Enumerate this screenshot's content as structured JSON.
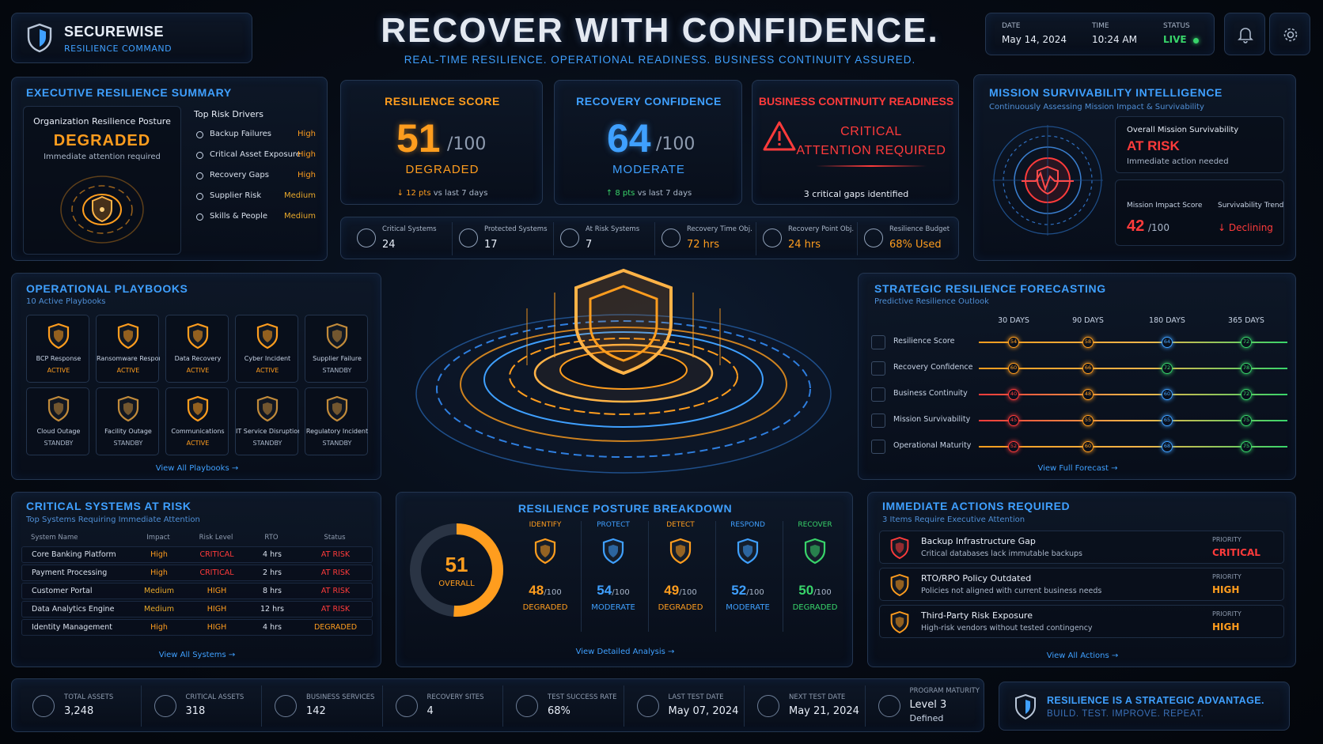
{
  "brand": {
    "name": "SECUREWISE",
    "tagline": "RESILIENCE COMMAND"
  },
  "hero": {
    "title": "RECOVER WITH CONFIDENCE.",
    "subtitle": "REAL-TIME RESILIENCE. OPERATIONAL READINESS. BUSINESS CONTINUITY ASSURED."
  },
  "header_status": {
    "date_label": "DATE",
    "date": "May 14, 2024",
    "time_label": "TIME",
    "time": "10:24 AM",
    "status_label": "STATUS",
    "status": "LIVE"
  },
  "exec_summary": {
    "title": "EXECUTIVE RESILIENCE SUMMARY",
    "posture_label": "Organization Resilience Posture",
    "posture": "DEGRADED",
    "posture_note": "Immediate attention required",
    "drivers_title": "Top Risk Drivers",
    "drivers": [
      {
        "name": "Backup Failures",
        "level": "High"
      },
      {
        "name": "Critical Asset Exposure",
        "level": "High"
      },
      {
        "name": "Recovery Gaps",
        "level": "High"
      },
      {
        "name": "Supplier Risk",
        "level": "Medium"
      },
      {
        "name": "Skills & People",
        "level": "Medium"
      }
    ]
  },
  "score_cards": {
    "resilience": {
      "title": "RESILIENCE SCORE",
      "value": "51",
      "max": "/100",
      "status": "DEGRADED",
      "trend_arrow": "↓",
      "trend": "12 pts",
      "trend_note": "vs last 7 days"
    },
    "confidence": {
      "title": "RECOVERY CONFIDENCE",
      "value": "64",
      "max": "/100",
      "status": "MODERATE",
      "trend_arrow": "↑",
      "trend": "8 pts",
      "trend_note": "vs last 7 days"
    },
    "continuity": {
      "title": "BUSINESS CONTINUITY READINESS",
      "line1": "CRITICAL",
      "line2": "ATTENTION REQUIRED",
      "note": "3 critical gaps identified"
    }
  },
  "metrics_strip": [
    {
      "label": "Critical Systems",
      "value": "24",
      "icon": "users-icon"
    },
    {
      "label": "Protected Systems",
      "value": "17",
      "icon": "shield-icon"
    },
    {
      "label": "At Risk Systems",
      "value": "7",
      "icon": "warning-icon"
    },
    {
      "label": "Recovery Time Obj.",
      "value": "72 hrs",
      "icon": "clock-icon"
    },
    {
      "label": "Recovery Point Obj.",
      "value": "24 hrs",
      "icon": "shield-check-icon"
    },
    {
      "label": "Resilience Budget",
      "value": "68% Used",
      "icon": "budget-icon"
    }
  ],
  "mission": {
    "title": "MISSION SURVIVABILITY INTELLIGENCE",
    "subtitle": "Continuously Assessing Mission Impact & Survivability",
    "overall_label": "Overall Mission Survivability",
    "overall": "AT RISK",
    "overall_note": "Immediate action needed",
    "impact_label": "Mission Impact Score",
    "impact_value": "42",
    "impact_max": "/100",
    "trend_label": "Survivability Trend",
    "trend": "↓ Declining"
  },
  "playbooks": {
    "title": "OPERATIONAL PLAYBOOKS",
    "subtitle": "10 Active Playbooks",
    "items": [
      {
        "name": "BCP Response",
        "status": "ACTIVE"
      },
      {
        "name": "Ransomware Response",
        "status": "ACTIVE"
      },
      {
        "name": "Data Recovery",
        "status": "ACTIVE"
      },
      {
        "name": "Cyber Incident",
        "status": "ACTIVE"
      },
      {
        "name": "Supplier Failure",
        "status": "STANDBY"
      },
      {
        "name": "Cloud Outage",
        "status": "STANDBY"
      },
      {
        "name": "Facility Outage",
        "status": "STANDBY"
      },
      {
        "name": "Communications",
        "status": "ACTIVE"
      },
      {
        "name": "IT Service Disruption",
        "status": "STANDBY"
      },
      {
        "name": "Regulatory Incident",
        "status": "STANDBY"
      }
    ],
    "link": "View All Playbooks →"
  },
  "forecast": {
    "title": "STRATEGIC RESILIENCE FORECASTING",
    "subtitle": "Predictive Resilience Outlook",
    "columns": [
      "30 DAYS",
      "90 DAYS",
      "180 DAYS",
      "365 DAYS"
    ],
    "rows": [
      {
        "name": "Resilience Score",
        "values": [
          54,
          58,
          64,
          72
        ]
      },
      {
        "name": "Recovery Confidence",
        "values": [
          60,
          66,
          72,
          78
        ]
      },
      {
        "name": "Business Continuity",
        "values": [
          40,
          48,
          60,
          72
        ]
      },
      {
        "name": "Mission Survivability",
        "values": [
          45,
          55,
          65,
          75
        ]
      },
      {
        "name": "Operational Maturity",
        "values": [
          52,
          60,
          68,
          75
        ]
      }
    ],
    "link": "View Full Forecast →"
  },
  "critical_systems": {
    "title": "CRITICAL SYSTEMS AT RISK",
    "subtitle": "Top Systems Requiring Immediate Attention",
    "headers": [
      "System Name",
      "Impact",
      "Risk Level",
      "RTO",
      "Status"
    ],
    "rows": [
      [
        "Core Banking Platform",
        "High",
        "CRITICAL",
        "4 hrs",
        "AT RISK"
      ],
      [
        "Payment Processing",
        "High",
        "CRITICAL",
        "2 hrs",
        "AT RISK"
      ],
      [
        "Customer Portal",
        "Medium",
        "HIGH",
        "8 hrs",
        "AT RISK"
      ],
      [
        "Data Analytics Engine",
        "Medium",
        "HIGH",
        "12 hrs",
        "AT RISK"
      ],
      [
        "Identity Management",
        "High",
        "HIGH",
        "4 hrs",
        "DEGRADED"
      ]
    ],
    "link": "View All Systems →"
  },
  "posture_breakdown": {
    "title": "RESILIENCE POSTURE BREAKDOWN",
    "overall_value": "51",
    "overall_label": "OVERALL",
    "overall_fraction": 0.51,
    "functions": [
      {
        "name": "IDENTIFY",
        "value": "48",
        "max": "/100",
        "status": "DEGRADED",
        "color": "#ff9d1e"
      },
      {
        "name": "PROTECT",
        "value": "54",
        "max": "/100",
        "status": "MODERATE",
        "color": "#3fa0ff"
      },
      {
        "name": "DETECT",
        "value": "49",
        "max": "/100",
        "status": "DEGRADED",
        "color": "#ff9d1e"
      },
      {
        "name": "RESPOND",
        "value": "52",
        "max": "/100",
        "status": "MODERATE",
        "color": "#3fa0ff"
      },
      {
        "name": "RECOVER",
        "value": "50",
        "max": "/100",
        "status": "DEGRADED",
        "color": "#38d46a"
      }
    ],
    "link": "View Detailed Analysis →"
  },
  "actions": {
    "title": "IMMEDIATE ACTIONS REQUIRED",
    "subtitle": "3 Items Require Executive Attention",
    "priority_label": "PRIORITY",
    "items": [
      {
        "title": "Backup Infrastructure Gap",
        "desc": "Critical databases lack immutable backups",
        "priority": "CRITICAL"
      },
      {
        "title": "RTO/RPO Policy Outdated",
        "desc": "Policies not aligned with current business needs",
        "priority": "HIGH"
      },
      {
        "title": "Third-Party Risk Exposure",
        "desc": "High-risk vendors without tested contingency",
        "priority": "HIGH"
      }
    ],
    "link": "View All Actions →"
  },
  "footer_stats": [
    {
      "label": "TOTAL ASSETS",
      "value": "3,248"
    },
    {
      "label": "CRITICAL ASSETS",
      "value": "318"
    },
    {
      "label": "BUSINESS SERVICES",
      "value": "142"
    },
    {
      "label": "RECOVERY SITES",
      "value": "4"
    },
    {
      "label": "TEST SUCCESS RATE",
      "value": "68%"
    },
    {
      "label": "LAST TEST DATE",
      "value": "May 07, 2024"
    },
    {
      "label": "NEXT TEST DATE",
      "value": "May 21, 2024"
    },
    {
      "label": "PROGRAM MATURITY",
      "value": "Level 3",
      "value2": "Defined"
    }
  ],
  "motto": {
    "line1": "RESILIENCE IS A STRATEGIC ADVANTAGE.",
    "line2": "BUILD. TEST. IMPROVE. REPEAT."
  },
  "colors": {
    "accent": "#3fa0ff",
    "warning": "#ff9d1e",
    "critical": "#ff3b3b",
    "ok": "#38d46a"
  }
}
